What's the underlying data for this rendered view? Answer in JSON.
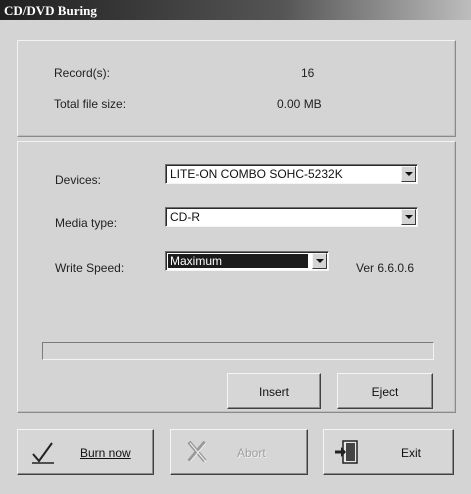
{
  "window": {
    "title": "CD/DVD Buring"
  },
  "summary": {
    "records_label": "Record(s):",
    "records_value": "16",
    "size_label": "Total file size:",
    "size_value": "0.00 MB"
  },
  "settings": {
    "devices_label": "Devices:",
    "devices_value": "LITE-ON  COMBO SOHC-5232K",
    "media_label": "Media type:",
    "media_value": "CD-R",
    "speed_label": "Write Speed:",
    "speed_value": "Maximum",
    "version": "Ver 6.6.0.6"
  },
  "progress": {
    "fraction": 0
  },
  "drive_buttons": {
    "insert": "Insert",
    "eject": "Eject"
  },
  "actions": {
    "burn_label": "Burn now",
    "abort_label": "Abort",
    "exit_label": "Exit"
  },
  "icons": {
    "burn": "checkmark-pen-icon",
    "abort": "x-cross-icon",
    "exit": "exit-door-icon"
  }
}
